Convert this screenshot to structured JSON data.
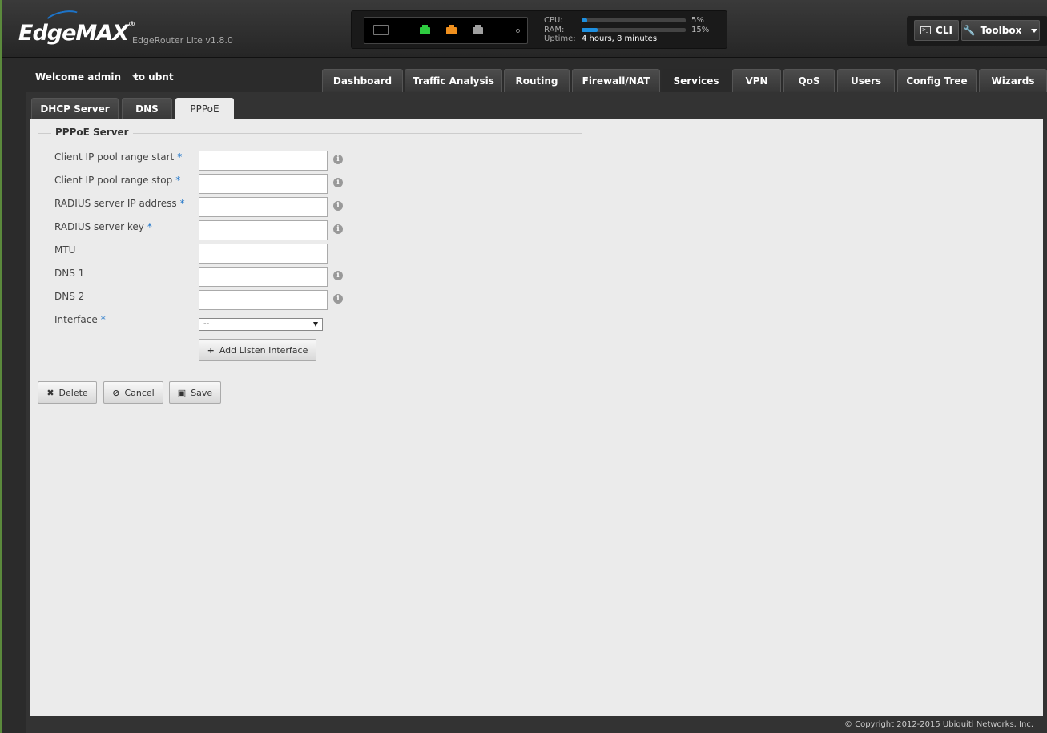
{
  "app": {
    "brand": "EdgeMAX",
    "model": "EdgeRouter Lite v1.8.0"
  },
  "status": {
    "cpu_label": "CPU:",
    "cpu_pct_text": "5%",
    "cpu_value": 0.05,
    "ram_label": "RAM:",
    "ram_pct_text": "15%",
    "ram_value": 0.15,
    "uptime_label": "Uptime:",
    "uptime_value": "4 hours, 8 minutes",
    "ports": [
      {
        "name": "console",
        "color": "#777777"
      },
      {
        "name": "eth0",
        "color": "#2ecc40"
      },
      {
        "name": "eth1",
        "color": "#f0901e"
      },
      {
        "name": "eth2",
        "color": "#a0a0a0"
      }
    ]
  },
  "toolbar": {
    "cli_label": "CLI",
    "toolbox_label": "Toolbox"
  },
  "user": {
    "welcome": "Welcome admin",
    "to_label": "to ubnt"
  },
  "main_tabs": [
    {
      "label": "Dashboard",
      "active": false
    },
    {
      "label": "Traffic Analysis",
      "active": false
    },
    {
      "label": "Routing",
      "active": false
    },
    {
      "label": "Firewall/NAT",
      "active": false
    },
    {
      "label": "Services",
      "active": true
    },
    {
      "label": "VPN",
      "active": false
    },
    {
      "label": "QoS",
      "active": false
    },
    {
      "label": "Users",
      "active": false
    },
    {
      "label": "Config Tree",
      "active": false
    },
    {
      "label": "Wizards",
      "active": false
    }
  ],
  "sub_tabs": [
    {
      "label": "DHCP Server",
      "active": false
    },
    {
      "label": "DNS",
      "active": false
    },
    {
      "label": "PPPoE",
      "active": true
    }
  ],
  "form": {
    "legend": "PPPoE Server",
    "fields": [
      {
        "label": "Client IP pool range start",
        "required": true,
        "value": "",
        "info": true
      },
      {
        "label": "Client IP pool range stop",
        "required": true,
        "value": "",
        "info": true
      },
      {
        "label": "RADIUS server IP address",
        "required": true,
        "value": "",
        "info": true
      },
      {
        "label": "RADIUS server key",
        "required": true,
        "value": "",
        "info": true
      },
      {
        "label": "MTU",
        "required": false,
        "value": "",
        "info": false
      },
      {
        "label": "DNS 1",
        "required": false,
        "value": "",
        "info": true
      },
      {
        "label": "DNS 2",
        "required": false,
        "value": "",
        "info": true
      }
    ],
    "interface_label": "Interface",
    "interface_required": true,
    "interface_value": "--",
    "add_listen_label": "Add Listen Interface",
    "required_mark": "*",
    "info_glyph": "i"
  },
  "actions": {
    "delete_label": "Delete",
    "cancel_label": "Cancel",
    "save_label": "Save"
  },
  "footer": {
    "copyright": "© Copyright 2012-2015 Ubiquiti Networks, Inc."
  }
}
